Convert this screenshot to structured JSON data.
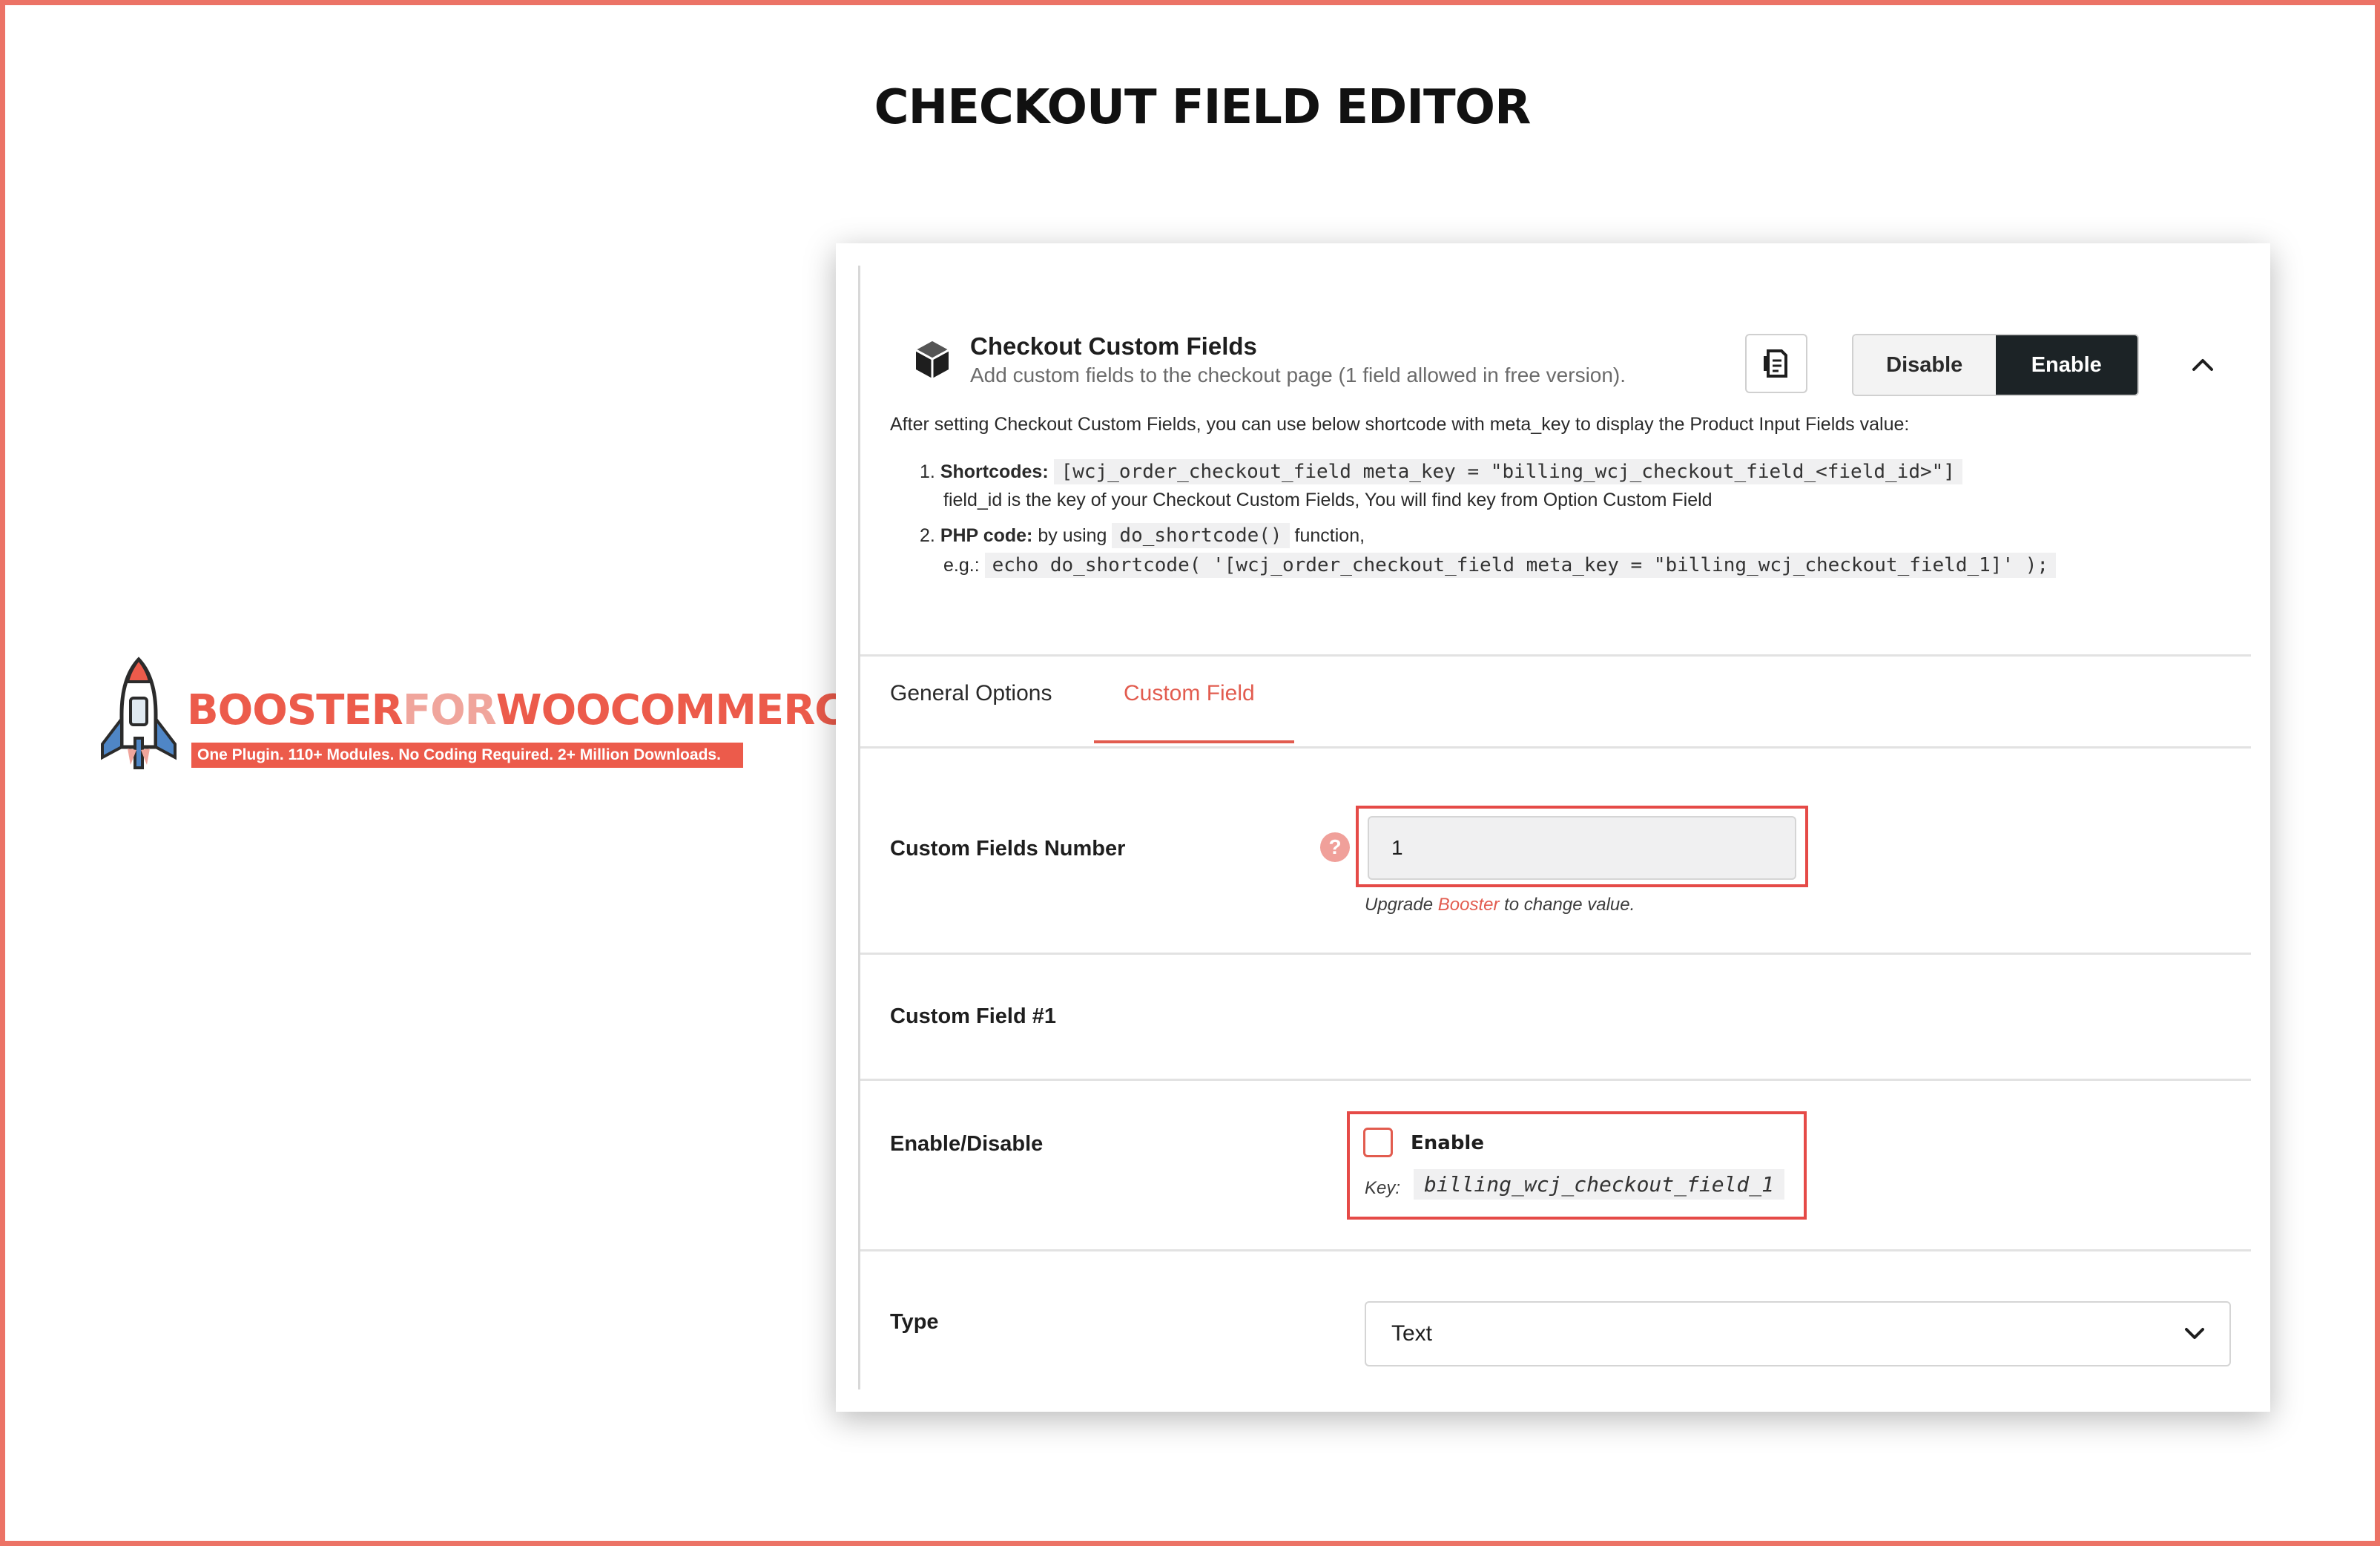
{
  "page": {
    "title": "CHECKOUT FIELD EDITOR"
  },
  "logo": {
    "word_booster": "BOOSTER",
    "word_for": "FOR",
    "word_woocommerce": "WOOCOMMERCE",
    "tagline": "One Plugin. 110+ Modules. No Coding Required. 2+ Million Downloads.",
    "brand_color": "#ec5b4b"
  },
  "module": {
    "icon": "cube-icon",
    "title": "Checkout Custom Fields",
    "description": "Add custom fields to the checkout page (1 field allowed in free version).",
    "doc_icon": "document-icon",
    "disable_label": "Disable",
    "enable_label": "Enable",
    "collapse_icon": "chevron-up-icon",
    "info": "After setting Checkout Custom Fields, you can use below shortcode with meta_key to display the Product Input Fields value:",
    "items": [
      {
        "num": "1.",
        "heading": "Shortcodes:",
        "code": "[wcj_order_checkout_field meta_key = \"billing_wcj_checkout_field_<field_id>\"]",
        "note": "field_id is the key of your Checkout Custom Fields, You will find key from Option Custom Field"
      },
      {
        "num": "2.",
        "heading": "PHP code:",
        "pre": "by using",
        "code": "do_shortcode()",
        "post": "function,",
        "eg_label": "e.g.:",
        "eg_code": "echo do_shortcode( '[wcj_order_checkout_field meta_key = \"billing_wcj_checkout_field_1]' );"
      }
    ]
  },
  "tabs": [
    {
      "label": "General Options",
      "active": false
    },
    {
      "label": "Custom Field",
      "active": true
    }
  ],
  "fields": {
    "custom_fields_number": {
      "label": "Custom Fields Number",
      "value": "1",
      "help": "?",
      "upgrade_pre": "Upgrade",
      "upgrade_link": "Booster",
      "upgrade_post": "to change value."
    },
    "custom_field_heading": "Custom Field #1",
    "enable_disable": {
      "label": "Enable/Disable",
      "checkbox_label": "Enable",
      "checked": false,
      "key_label": "Key:",
      "key_value": "billing_wcj_checkout_field_1"
    },
    "type": {
      "label": "Type",
      "selected": "Text"
    }
  },
  "colors": {
    "accent": "#e25c4f",
    "highlight": "#e54a47",
    "frame": "#ec7366",
    "dark_button": "#1c2326"
  }
}
